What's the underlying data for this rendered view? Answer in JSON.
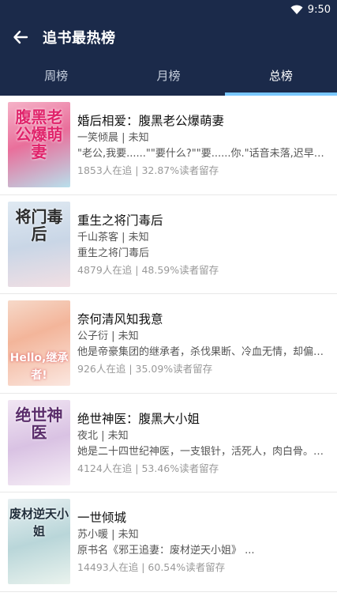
{
  "status": {
    "time": "9:50"
  },
  "header": {
    "title": "追书最热榜"
  },
  "tabs": [
    {
      "label": "周榜"
    },
    {
      "label": "月榜"
    },
    {
      "label": "总榜"
    }
  ],
  "books": [
    {
      "title": "婚后相爱：腹黑老公爆萌妻",
      "author": "一笑倾晨 | 未知",
      "desc": "\"老公,我要......\"\"要什么?\"\"要......你.\"话音未落,迟早早就猛然...",
      "stats": "1853人在追 | 32.87%读者留存",
      "cover_text": "腹黑老公爆萌妻"
    },
    {
      "title": "重生之将门毒后",
      "author": "千山茶客 | 未知",
      "desc": "重生之将门毒后",
      "stats": "4879人在追 | 48.59%读者留存",
      "cover_text": "将门毒后"
    },
    {
      "title": "奈何清风知我意",
      "author": "公子衍 | 未知",
      "desc": " 他是帝豪集团的继承者，杀伐果断、冷血无情，却偏偏...",
      "stats": "926人在追 | 35.09%读者留存",
      "cover_text": "Hello,继承者!"
    },
    {
      "title": "绝世神医：腹黑大小姐",
      "author": "夜北 | 未知",
      "desc": "她是二十四世纪神医，一支银针，活死人，肉白骨。一...",
      "stats": "4124人在追 | 53.46%读者留存",
      "cover_text": "绝世神医"
    },
    {
      "title": "一世倾城",
      "author": "苏小暖 | 未知",
      "desc": "原书名《邪王追妻：废材逆天小姐》 ...",
      "stats": "14493人在追 | 60.54%读者留存",
      "cover_text": "废材逆天小姐"
    }
  ],
  "colors": {
    "header_bg": "#1b2a4a",
    "tab_indicator": "#79c7ff"
  }
}
